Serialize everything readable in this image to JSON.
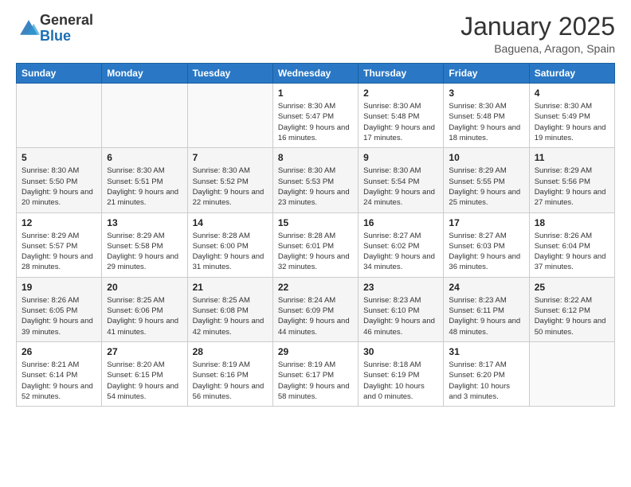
{
  "logo": {
    "general": "General",
    "blue": "Blue"
  },
  "title": "January 2025",
  "location": "Baguena, Aragon, Spain",
  "days_of_week": [
    "Sunday",
    "Monday",
    "Tuesday",
    "Wednesday",
    "Thursday",
    "Friday",
    "Saturday"
  ],
  "weeks": [
    [
      {
        "day": "",
        "empty": true
      },
      {
        "day": "",
        "empty": true
      },
      {
        "day": "",
        "empty": true
      },
      {
        "day": "1",
        "sunrise": "8:30 AM",
        "sunset": "5:47 PM",
        "daylight": "9 hours and 16 minutes."
      },
      {
        "day": "2",
        "sunrise": "8:30 AM",
        "sunset": "5:48 PM",
        "daylight": "9 hours and 17 minutes."
      },
      {
        "day": "3",
        "sunrise": "8:30 AM",
        "sunset": "5:48 PM",
        "daylight": "9 hours and 18 minutes."
      },
      {
        "day": "4",
        "sunrise": "8:30 AM",
        "sunset": "5:49 PM",
        "daylight": "9 hours and 19 minutes."
      }
    ],
    [
      {
        "day": "5",
        "sunrise": "8:30 AM",
        "sunset": "5:50 PM",
        "daylight": "9 hours and 20 minutes."
      },
      {
        "day": "6",
        "sunrise": "8:30 AM",
        "sunset": "5:51 PM",
        "daylight": "9 hours and 21 minutes."
      },
      {
        "day": "7",
        "sunrise": "8:30 AM",
        "sunset": "5:52 PM",
        "daylight": "9 hours and 22 minutes."
      },
      {
        "day": "8",
        "sunrise": "8:30 AM",
        "sunset": "5:53 PM",
        "daylight": "9 hours and 23 minutes."
      },
      {
        "day": "9",
        "sunrise": "8:30 AM",
        "sunset": "5:54 PM",
        "daylight": "9 hours and 24 minutes."
      },
      {
        "day": "10",
        "sunrise": "8:29 AM",
        "sunset": "5:55 PM",
        "daylight": "9 hours and 25 minutes."
      },
      {
        "day": "11",
        "sunrise": "8:29 AM",
        "sunset": "5:56 PM",
        "daylight": "9 hours and 27 minutes."
      }
    ],
    [
      {
        "day": "12",
        "sunrise": "8:29 AM",
        "sunset": "5:57 PM",
        "daylight": "9 hours and 28 minutes."
      },
      {
        "day": "13",
        "sunrise": "8:29 AM",
        "sunset": "5:58 PM",
        "daylight": "9 hours and 29 minutes."
      },
      {
        "day": "14",
        "sunrise": "8:28 AM",
        "sunset": "6:00 PM",
        "daylight": "9 hours and 31 minutes."
      },
      {
        "day": "15",
        "sunrise": "8:28 AM",
        "sunset": "6:01 PM",
        "daylight": "9 hours and 32 minutes."
      },
      {
        "day": "16",
        "sunrise": "8:27 AM",
        "sunset": "6:02 PM",
        "daylight": "9 hours and 34 minutes."
      },
      {
        "day": "17",
        "sunrise": "8:27 AM",
        "sunset": "6:03 PM",
        "daylight": "9 hours and 36 minutes."
      },
      {
        "day": "18",
        "sunrise": "8:26 AM",
        "sunset": "6:04 PM",
        "daylight": "9 hours and 37 minutes."
      }
    ],
    [
      {
        "day": "19",
        "sunrise": "8:26 AM",
        "sunset": "6:05 PM",
        "daylight": "9 hours and 39 minutes."
      },
      {
        "day": "20",
        "sunrise": "8:25 AM",
        "sunset": "6:06 PM",
        "daylight": "9 hours and 41 minutes."
      },
      {
        "day": "21",
        "sunrise": "8:25 AM",
        "sunset": "6:08 PM",
        "daylight": "9 hours and 42 minutes."
      },
      {
        "day": "22",
        "sunrise": "8:24 AM",
        "sunset": "6:09 PM",
        "daylight": "9 hours and 44 minutes."
      },
      {
        "day": "23",
        "sunrise": "8:23 AM",
        "sunset": "6:10 PM",
        "daylight": "9 hours and 46 minutes."
      },
      {
        "day": "24",
        "sunrise": "8:23 AM",
        "sunset": "6:11 PM",
        "daylight": "9 hours and 48 minutes."
      },
      {
        "day": "25",
        "sunrise": "8:22 AM",
        "sunset": "6:12 PM",
        "daylight": "9 hours and 50 minutes."
      }
    ],
    [
      {
        "day": "26",
        "sunrise": "8:21 AM",
        "sunset": "6:14 PM",
        "daylight": "9 hours and 52 minutes."
      },
      {
        "day": "27",
        "sunrise": "8:20 AM",
        "sunset": "6:15 PM",
        "daylight": "9 hours and 54 minutes."
      },
      {
        "day": "28",
        "sunrise": "8:19 AM",
        "sunset": "6:16 PM",
        "daylight": "9 hours and 56 minutes."
      },
      {
        "day": "29",
        "sunrise": "8:19 AM",
        "sunset": "6:17 PM",
        "daylight": "9 hours and 58 minutes."
      },
      {
        "day": "30",
        "sunrise": "8:18 AM",
        "sunset": "6:19 PM",
        "daylight": "10 hours and 0 minutes."
      },
      {
        "day": "31",
        "sunrise": "8:17 AM",
        "sunset": "6:20 PM",
        "daylight": "10 hours and 3 minutes."
      },
      {
        "day": "",
        "empty": true
      }
    ]
  ]
}
